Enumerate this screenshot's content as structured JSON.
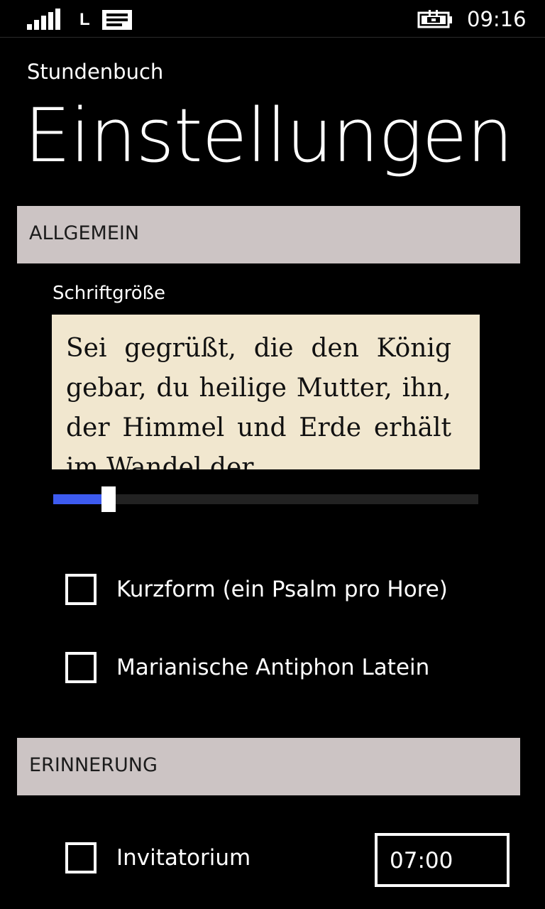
{
  "status_bar": {
    "network_type": "L",
    "clock": "09:16",
    "icons": [
      "signal-icon",
      "message-icon",
      "battery-charging-icon"
    ]
  },
  "app": {
    "title": "Stundenbuch",
    "page_title": "Einstellungen"
  },
  "sections": {
    "general": {
      "label": "ALLGEMEIN",
      "font_size_label": "Schriftgröße",
      "preview_text": "Sei gegrüßt, die den König gebar, du heilige Mutter, ihn, der Himmel und Erde erhält im Wandel der",
      "font_size_slider_value": 0.13,
      "options": [
        {
          "label": "Kurzform (ein Psalm pro Hore)",
          "checked": false
        },
        {
          "label": "Marianische Antiphon Latein",
          "checked": false
        }
      ]
    },
    "reminder": {
      "label": "ERINNERUNG",
      "options": [
        {
          "label": "Invitatorium",
          "checked": false,
          "time": "07:00"
        }
      ]
    }
  },
  "colors": {
    "background": "#000000",
    "section_header_bg": "#ccc4c4",
    "accent": "#3d5bf0",
    "preview_bg": "#f1e7cf"
  }
}
